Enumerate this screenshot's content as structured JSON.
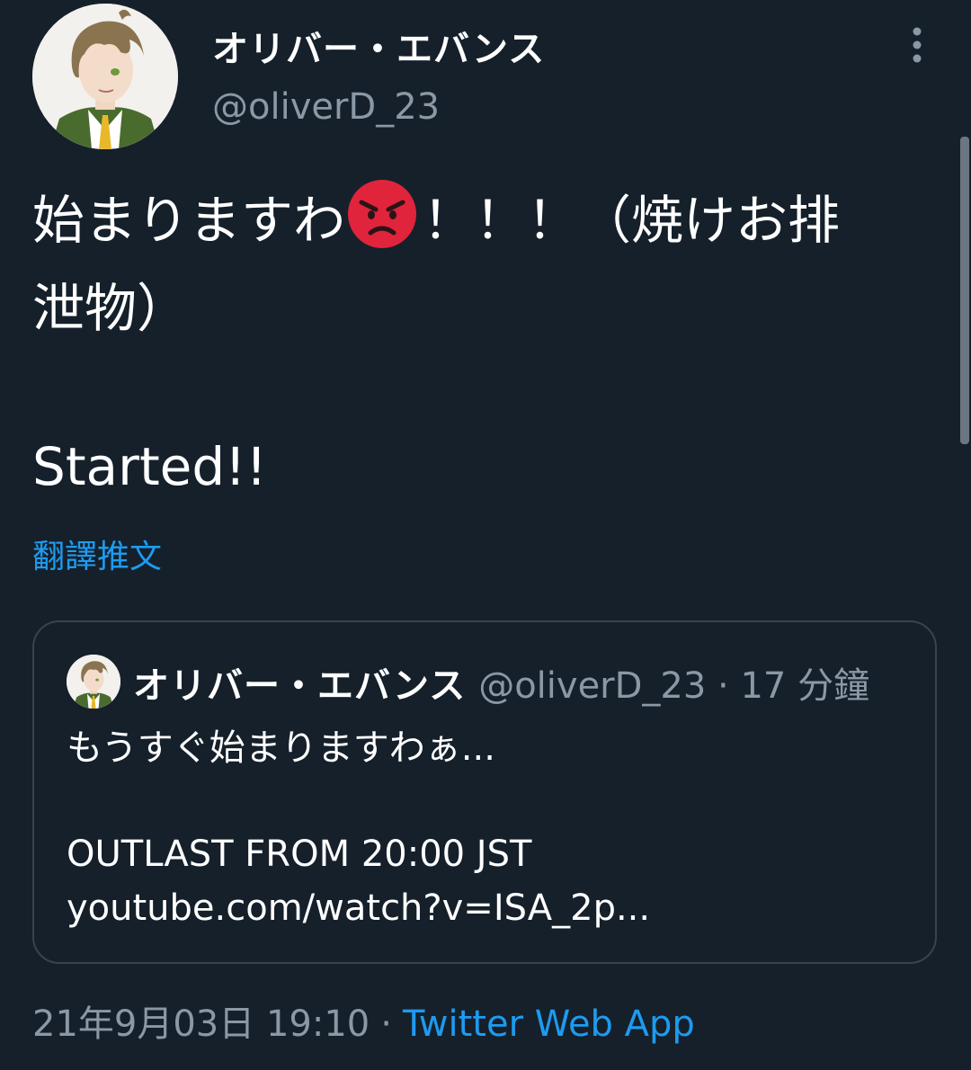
{
  "author": {
    "display_name": "オリバー・エバンス",
    "handle": "@oliverD_23"
  },
  "tweet": {
    "text_line1_before_emoji": "始まりますわ",
    "emoji": "angry-face",
    "text_line1_after_emoji": "！！！（焼けお排",
    "text_line2": "泄物）",
    "text_line3": "Started!!",
    "translate_label": "翻譯推文"
  },
  "quote": {
    "display_name": "オリバー・エバンス",
    "meta": "@oliverD_23 · 17 分鐘",
    "line1": "もうすぐ始まりますわぁ...",
    "line2": "OUTLAST FROM 20:00 JST",
    "line3": "youtube.com/watch?v=ISA_2p..."
  },
  "footer": {
    "timestamp": "21年9月03日 19:10",
    "separator": "·",
    "source": "Twitter Web App"
  },
  "colors": {
    "background": "#15202b",
    "text_primary": "#ffffff",
    "text_secondary": "#8b98a5",
    "link": "#1d9bf0",
    "border": "#38444d",
    "emoji_red": "#e0243c"
  },
  "icons": [
    "more-vertical-icon",
    "angry-face-icon",
    "avatar-image"
  ]
}
